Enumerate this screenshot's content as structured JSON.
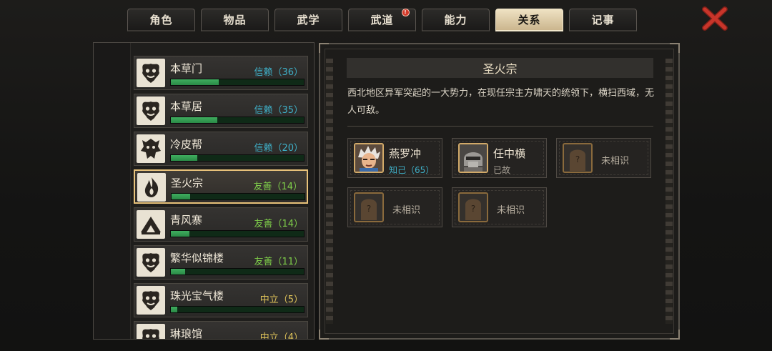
{
  "tabs": [
    {
      "label": "角色"
    },
    {
      "label": "物品"
    },
    {
      "label": "武学"
    },
    {
      "label": "武道",
      "badge": "!"
    },
    {
      "label": "能力"
    },
    {
      "label": "关系",
      "active": true
    },
    {
      "label": "记事"
    }
  ],
  "factions": [
    {
      "name": "本草门",
      "status": "信赖（36）",
      "level": 36,
      "tone": "trust",
      "emblem": "demon-mask-emblem-icon"
    },
    {
      "name": "本草居",
      "status": "信赖（35）",
      "level": 35,
      "tone": "trust",
      "emblem": "demon-mask-emblem-icon"
    },
    {
      "name": "冷皮帮",
      "status": "信赖（20）",
      "level": 20,
      "tone": "trust",
      "emblem": "beast-emblem-icon"
    },
    {
      "name": "圣火宗",
      "status": "友善（14）",
      "level": 14,
      "tone": "friendly",
      "selected": true,
      "emblem": "flame-emblem-icon"
    },
    {
      "name": "青风寨",
      "status": "友善（14）",
      "level": 14,
      "tone": "friendly",
      "emblem": "mountain-emblem-icon"
    },
    {
      "name": "繁华似锦楼",
      "status": "友善（11）",
      "level": 11,
      "tone": "friendly",
      "emblem": "demon-mask-emblem-icon"
    },
    {
      "name": "珠光宝气楼",
      "status": "中立（5）",
      "level": 5,
      "tone": "neutral",
      "emblem": "demon-mask-emblem-icon"
    },
    {
      "name": "琳琅馆",
      "status": "中立（4）",
      "level": 4,
      "tone": "neutral",
      "emblem": "demon-mask-emblem-icon"
    }
  ],
  "detail": {
    "title": "圣火宗",
    "description": "西北地区异军突起的一大势力，在现任宗主方啸天的统领下，横扫西域，无人可敌。",
    "characters": [
      {
        "name": "燕罗冲",
        "status": "知己（65）",
        "known": true,
        "status_tone": "close",
        "portrait": "white-haired-swordsman-portrait"
      },
      {
        "name": "任中横",
        "status": "已故",
        "known": true,
        "status_tone": "deceased",
        "portrait": "helmeted-warrior-portrait"
      },
      {
        "unknown_label": "未相识",
        "known": false,
        "portrait": "unknown-question-portrait"
      },
      {
        "unknown_label": "未相识",
        "known": false,
        "portrait": "unknown-question-portrait"
      },
      {
        "unknown_label": "未相识",
        "known": false,
        "portrait": "unknown-question-portrait"
      }
    ]
  },
  "colors": {
    "trust": "#3fb0c8",
    "friendly": "#7fcf4a",
    "neutral": "#e0c45a",
    "close": "#3fb0c8",
    "deceased": "#a8a196",
    "accent_gold": "#e8c27a",
    "close_x": "#c8352a"
  },
  "icons": {
    "close": "close-x-icon"
  }
}
